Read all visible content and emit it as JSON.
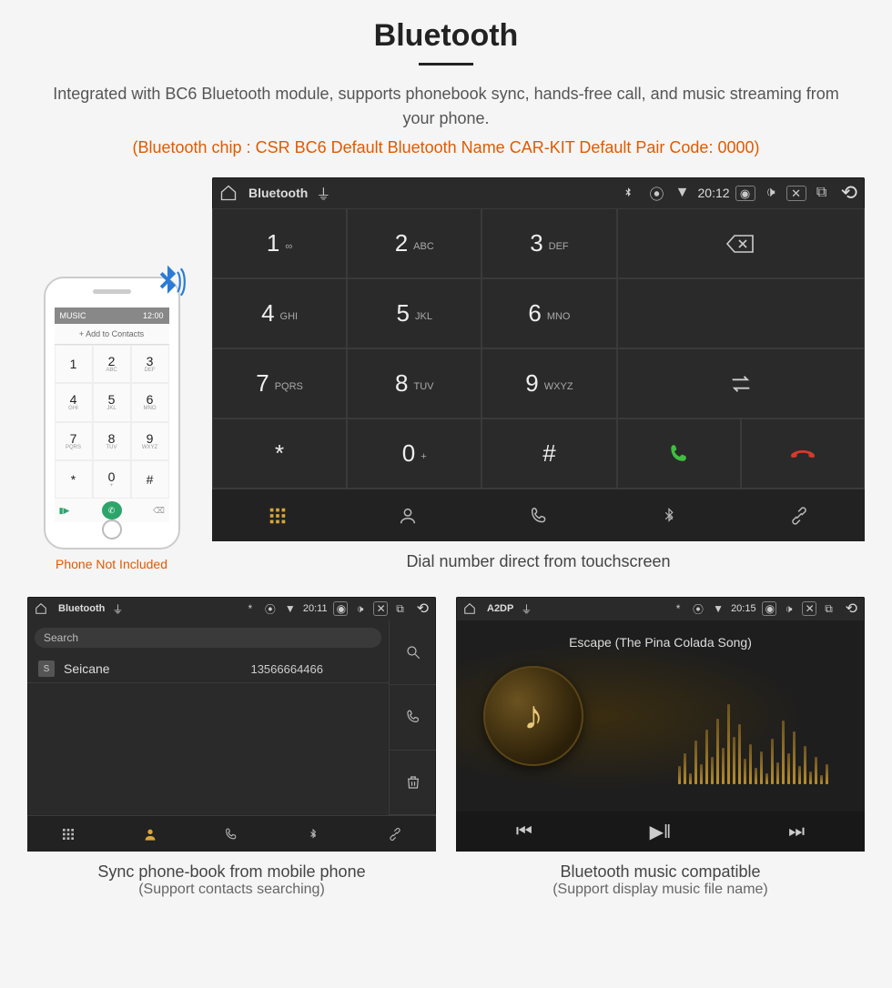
{
  "header": {
    "title": "Bluetooth",
    "subtitle": "Integrated with BC6 Bluetooth module, supports phonebook sync, hands-free call, and music streaming from your phone.",
    "spec": "(Bluetooth chip : CSR BC6     Default Bluetooth Name CAR-KIT     Default Pair Code: 0000)"
  },
  "phone_mock": {
    "top": "MUSIC",
    "time": "12:00",
    "add_contacts": "+   Add to Contacts",
    "note": "Phone Not Included",
    "keys": [
      {
        "n": "1",
        "l": ""
      },
      {
        "n": "2",
        "l": "ABC"
      },
      {
        "n": "3",
        "l": "DEF"
      },
      {
        "n": "4",
        "l": "GHI"
      },
      {
        "n": "5",
        "l": "JKL"
      },
      {
        "n": "6",
        "l": "MNO"
      },
      {
        "n": "7",
        "l": "PQRS"
      },
      {
        "n": "8",
        "l": "TUV"
      },
      {
        "n": "9",
        "l": "WXYZ"
      },
      {
        "n": "*",
        "l": ""
      },
      {
        "n": "0",
        "l": "+"
      },
      {
        "n": "#",
        "l": ""
      }
    ]
  },
  "dialer": {
    "status": {
      "title": "Bluetooth",
      "time": "20:12"
    },
    "keys": [
      {
        "n": "1",
        "l": "∞"
      },
      {
        "n": "2",
        "l": "ABC"
      },
      {
        "n": "3",
        "l": "DEF"
      },
      {
        "n": "4",
        "l": "GHI"
      },
      {
        "n": "5",
        "l": "JKL"
      },
      {
        "n": "6",
        "l": "MNO"
      },
      {
        "n": "7",
        "l": "PQRS"
      },
      {
        "n": "8",
        "l": "TUV"
      },
      {
        "n": "9",
        "l": "WXYZ"
      },
      {
        "n": "*",
        "l": ""
      },
      {
        "n": "0",
        "l": "+"
      },
      {
        "n": "#",
        "l": ""
      }
    ],
    "caption": "Dial number direct from touchscreen"
  },
  "contacts": {
    "status": {
      "title": "Bluetooth",
      "time": "20:11"
    },
    "search_placeholder": "Search",
    "list": [
      {
        "initial": "S",
        "name": "Seicane",
        "number": "13566664466"
      }
    ],
    "caption": "Sync phone-book from mobile phone",
    "caption_sub": "(Support contacts searching)"
  },
  "music": {
    "status": {
      "title": "A2DP",
      "time": "20:15"
    },
    "song": "Escape (The Pina Colada Song)",
    "eq_heights": [
      20,
      34,
      12,
      48,
      22,
      60,
      30,
      72,
      40,
      88,
      52,
      66,
      28,
      44,
      18,
      36,
      12,
      50,
      24,
      70,
      34,
      58,
      20,
      42,
      14,
      30,
      10,
      22
    ],
    "caption": "Bluetooth music compatible",
    "caption_sub": "(Support display music file name)"
  }
}
